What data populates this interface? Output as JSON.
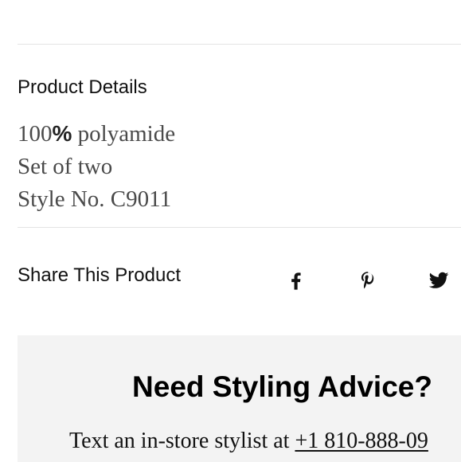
{
  "product_details": {
    "heading": "Product Details",
    "items": [
      {
        "prefix": "100",
        "accent": "%",
        "suffix": " polyamide"
      },
      {
        "prefix": "Set of two",
        "accent": "",
        "suffix": ""
      },
      {
        "prefix": "Style No. C9011",
        "accent": "",
        "suffix": ""
      }
    ]
  },
  "share": {
    "heading": "Share This Product",
    "icons": [
      "facebook-icon",
      "pinterest-icon",
      "twitter-icon"
    ]
  },
  "styling_advice": {
    "title": "Need Styling Advice?",
    "text_prefix": "Text an in-store stylist at ",
    "phone": "+1 810-888-09"
  },
  "colors": {
    "background": "#ffffff",
    "panel": "#f3f3f3",
    "divider": "#e3e3e3",
    "text": "#111111",
    "muted_text": "#4a4a4a"
  }
}
